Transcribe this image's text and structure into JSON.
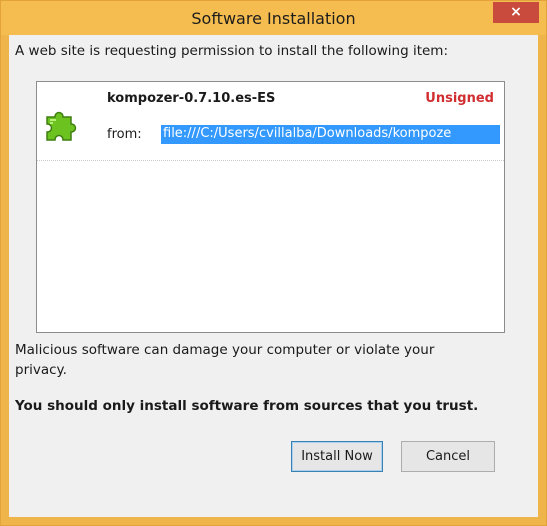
{
  "window": {
    "title": "Software Installation",
    "close_label": "×",
    "accent_color": "#f0b54a",
    "close_color": "#c84b3e"
  },
  "prompt": "A web site is requesting permission to install the following item:",
  "item": {
    "icon": "puzzle-piece-icon",
    "name": "kompozer-0.7.10.es-ES",
    "status": "Unsigned",
    "status_color": "#d12e32",
    "from_label": "from:",
    "url": "file:///C:/Users/cvillalba/Downloads/kompoze"
  },
  "warning": {
    "line1": "Malicious software can damage your computer or violate your privacy.",
    "line2": "You should only install software from sources that you trust."
  },
  "buttons": {
    "install": "Install Now",
    "cancel": "Cancel"
  }
}
